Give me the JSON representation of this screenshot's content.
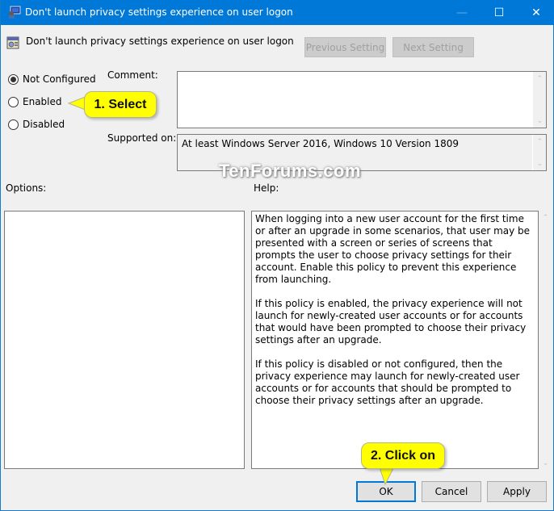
{
  "window": {
    "title": "Don't launch privacy settings experience on user logon",
    "controls": {
      "minimize": "—",
      "maximize": "☐",
      "close": "✕"
    }
  },
  "header": {
    "policy_name": "Don't launch privacy settings experience on user logon",
    "previous_setting_label": "Previous Setting",
    "next_setting_label": "Next Setting"
  },
  "state": {
    "options": [
      {
        "label": "Not Configured",
        "checked": true
      },
      {
        "label": "Enabled",
        "checked": false
      },
      {
        "label": "Disabled",
        "checked": false
      }
    ]
  },
  "comment": {
    "label": "Comment:",
    "value": ""
  },
  "supported": {
    "label": "Supported on:",
    "value": "At least Windows Server 2016, Windows 10 Version 1809"
  },
  "options_label": "Options:",
  "help": {
    "label": "Help:",
    "paragraphs": [
      "When logging into a new user account for the first time or after an upgrade in some scenarios, that user may be presented with a screen or series of screens that prompts the user to choose privacy settings for their account. Enable this policy to prevent this experience from launching.",
      "If this policy is enabled, the privacy experience will not launch for newly-created user accounts or for accounts that would have been prompted to choose their privacy settings after an upgrade.",
      "If this policy is disabled or not configured, then the privacy experience may launch for newly-created user accounts or for accounts that should be prompted to choose their privacy settings after an upgrade."
    ]
  },
  "footer": {
    "ok_label": "OK",
    "cancel_label": "Cancel",
    "apply_label": "Apply"
  },
  "annotations": {
    "callout1": "1. Select",
    "callout2": "2. Click on",
    "watermark": "TenForums.com"
  },
  "colors": {
    "titlebar": "#0078d7",
    "callout": "#ffff00",
    "focus": "#0078d7"
  }
}
